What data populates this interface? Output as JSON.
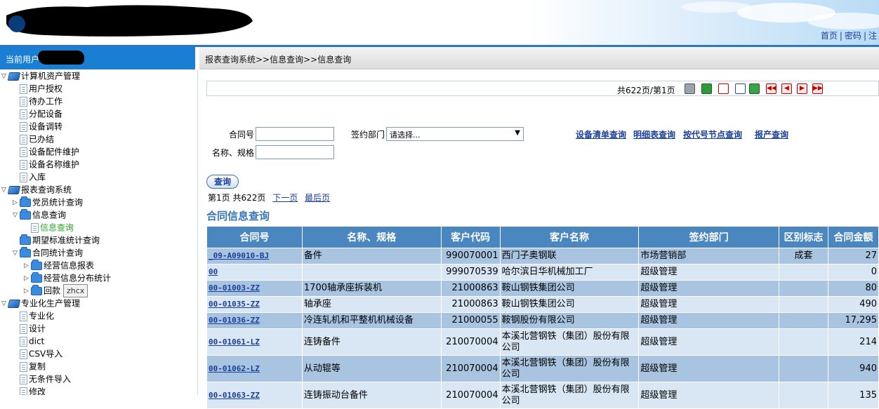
{
  "header": {
    "nav_links": [
      "首页",
      "密码",
      "注"
    ]
  },
  "userbar": {
    "label": "当前用户"
  },
  "sidebar": {
    "nodes": [
      {
        "label": "计算机资产管理",
        "level": 0,
        "icon": "book-icon",
        "twist": "▽"
      },
      {
        "label": "用户授权",
        "level": 1,
        "icon": "page-icon"
      },
      {
        "label": "待办工作",
        "level": 1,
        "icon": "page-icon"
      },
      {
        "label": "分配设备",
        "level": 1,
        "icon": "page-icon"
      },
      {
        "label": "设备调转",
        "level": 1,
        "icon": "page-icon"
      },
      {
        "label": "已办结",
        "level": 1,
        "icon": "page-icon"
      },
      {
        "label": "设备配件维护",
        "level": 1,
        "icon": "page-icon"
      },
      {
        "label": "设备名称维护",
        "level": 1,
        "icon": "page-icon"
      },
      {
        "label": "入库",
        "level": 1,
        "icon": "page-icon"
      },
      {
        "label": "报表查询系统",
        "level": 0,
        "icon": "book-icon",
        "twist": "▽"
      },
      {
        "label": "党员统计查询",
        "level": 1,
        "icon": "folder-icon",
        "twist": "▷"
      },
      {
        "label": "信息查询",
        "level": 1,
        "icon": "folder-icon",
        "twist": "▽"
      },
      {
        "label": "信息查询",
        "level": 2,
        "icon": "page-icon",
        "selected": true
      },
      {
        "label": "期望标准统计查询",
        "level": 1,
        "icon": "folder-icon"
      },
      {
        "label": "合同统计查询",
        "level": 1,
        "icon": "folder-icon",
        "twist": "▽"
      },
      {
        "label": "经营信息报表",
        "level": 2,
        "icon": "folder-icon",
        "twist": "▷"
      },
      {
        "label": "经营信息分布统计",
        "level": 2,
        "icon": "folder-icon",
        "twist": "▷"
      },
      {
        "label": "回款",
        "level": 2,
        "icon": "folder-icon",
        "twist": "▷"
      },
      {
        "label": "专业化生产管理",
        "level": 0,
        "icon": "book-icon",
        "twist": "▽"
      },
      {
        "label": "专业化",
        "level": 1,
        "icon": "page-icon"
      },
      {
        "label": "设计",
        "level": 1,
        "icon": "page-icon"
      },
      {
        "label": "dict",
        "level": 1,
        "icon": "page-icon"
      },
      {
        "label": "CSV导入",
        "level": 1,
        "icon": "page-icon"
      },
      {
        "label": "复制",
        "level": 1,
        "icon": "page-icon"
      },
      {
        "label": "无条件导入",
        "level": 1,
        "icon": "page-icon"
      },
      {
        "label": "修改",
        "level": 1,
        "icon": "page-icon"
      }
    ],
    "tooltip": "zhcx"
  },
  "main": {
    "breadcrumb": "报表查询系统>>信息查询>>信息查询",
    "toolbar": {
      "page_info": "共622页/第1页",
      "icons": [
        "print-icon",
        "excel-icon",
        "pdf-icon",
        "word-icon",
        "export-icon",
        "first-page-icon",
        "prev-page-icon",
        "next-page-icon",
        "last-page-icon"
      ]
    },
    "form": {
      "contract_label": "合同号",
      "contract_value": "",
      "dept_label": "签约部门",
      "dept_select": "请选择...",
      "name_label": "名称、规格",
      "name_value": "",
      "links": [
        "设备清单查询",
        "明细表查询",
        "按代号节点查询",
        "报产查询"
      ],
      "query_button": "查询"
    },
    "pager": {
      "current": "第1页",
      "total": "共622页",
      "next": "下一页",
      "last": "最后页"
    },
    "section_title": "合同信息查询",
    "table": {
      "columns": [
        "合同号",
        "名称、规格",
        "客户代码",
        "客户名称",
        "签约部门",
        "区别标志",
        "合同金额"
      ],
      "rows": [
        [
          "_09-A09010-BJ",
          "备件",
          "990070001",
          "西门子奥钢联",
          "市场营销部",
          "成套",
          "27"
        ],
        [
          "00",
          "",
          "999070539",
          "哈尔滨日华机械加工厂",
          "超级管理",
          "",
          "0"
        ],
        [
          "00-01003-ZZ",
          "1700轴承座拆装机",
          "21000863",
          "鞍山钢铁集团公司",
          "超级管理",
          "",
          "80"
        ],
        [
          "00-01035-ZZ",
          "轴承座",
          "21000863",
          "鞍山钢铁集团公司",
          "超级管理",
          "",
          "490"
        ],
        [
          "00-01036-ZZ",
          "冷连轧机和平整机机械设备",
          "21000055",
          "鞍钢股份有限公司",
          "超级管理",
          "",
          "17,295"
        ],
        [
          "00-01061-LZ",
          "连铸备件",
          "210070004",
          "本溪北营钢铁（集团）股份有限公司",
          "超级管理",
          "",
          "214"
        ],
        [
          "00-01062-LZ",
          "从动辊等",
          "210070004",
          "本溪北营钢铁（集团）股份有限公司",
          "超级管理",
          "",
          "940"
        ],
        [
          "00-01063-ZZ",
          "连铸振动台备件",
          "210070004",
          "本溪北营钢铁（集团）股份有限公司",
          "超级管理",
          "",
          "135"
        ]
      ]
    }
  }
}
